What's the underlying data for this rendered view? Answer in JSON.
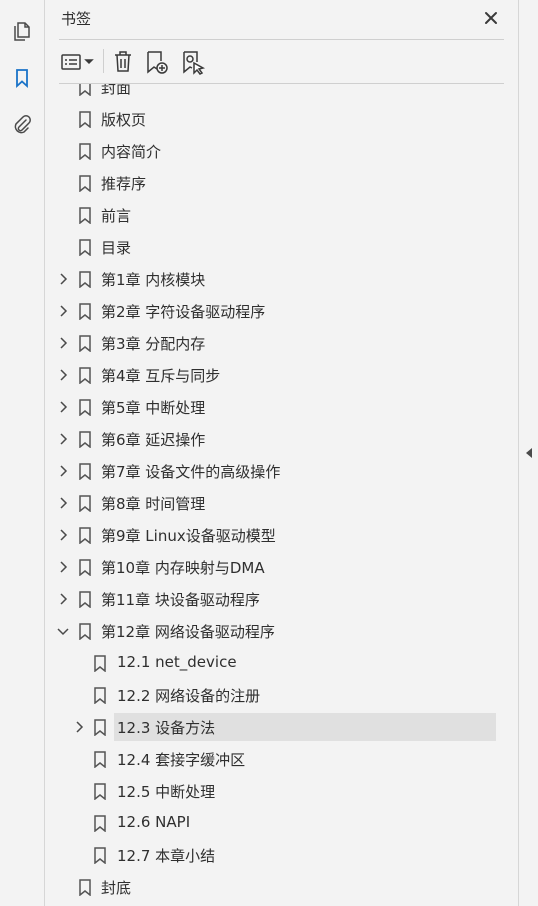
{
  "rail": {
    "pages_icon": "pages-icon",
    "bookmarks_icon": "bookmark-icon",
    "attachments_icon": "paperclip-icon",
    "accent": "#1a73c8"
  },
  "panel": {
    "title": "书签",
    "close_icon": "close-icon"
  },
  "toolbar": {
    "options_icon": "list-options-icon",
    "delete_icon": "trash-icon",
    "new_bookmark_icon": "new-bookmark-icon",
    "new_from_structure_icon": "bookmark-from-structure-icon"
  },
  "bookmarks": [
    {
      "label": "封面",
      "level": 0,
      "expandable": false
    },
    {
      "label": "版权页",
      "level": 0,
      "expandable": false
    },
    {
      "label": "内容简介",
      "level": 0,
      "expandable": false
    },
    {
      "label": "推荐序",
      "level": 0,
      "expandable": false
    },
    {
      "label": "前言",
      "level": 0,
      "expandable": false
    },
    {
      "label": "目录",
      "level": 0,
      "expandable": false
    },
    {
      "label": "第1章 内核模块",
      "level": 0,
      "expandable": true,
      "expanded": false
    },
    {
      "label": "第2章 字符设备驱动程序",
      "level": 0,
      "expandable": true,
      "expanded": false
    },
    {
      "label": "第3章 分配内存",
      "level": 0,
      "expandable": true,
      "expanded": false
    },
    {
      "label": "第4章 互斥与同步",
      "level": 0,
      "expandable": true,
      "expanded": false
    },
    {
      "label": "第5章 中断处理",
      "level": 0,
      "expandable": true,
      "expanded": false
    },
    {
      "label": "第6章 延迟操作",
      "level": 0,
      "expandable": true,
      "expanded": false
    },
    {
      "label": "第7章 设备文件的高级操作",
      "level": 0,
      "expandable": true,
      "expanded": false
    },
    {
      "label": "第8章 时间管理",
      "level": 0,
      "expandable": true,
      "expanded": false
    },
    {
      "label": "第9章 Linux设备驱动模型",
      "level": 0,
      "expandable": true,
      "expanded": false
    },
    {
      "label": "第10章 内存映射与DMA",
      "level": 0,
      "expandable": true,
      "expanded": false
    },
    {
      "label": "第11章 块设备驱动程序",
      "level": 0,
      "expandable": true,
      "expanded": false
    },
    {
      "label": "第12章 网络设备驱动程序",
      "level": 0,
      "expandable": true,
      "expanded": true
    },
    {
      "label": "12.1 net_device",
      "level": 1,
      "expandable": false
    },
    {
      "label": "12.2 网络设备的注册",
      "level": 1,
      "expandable": false
    },
    {
      "label": "12.3 设备方法",
      "level": 1,
      "expandable": true,
      "expanded": false,
      "selected": true
    },
    {
      "label": "12.4 套接字缓冲区",
      "level": 1,
      "expandable": false
    },
    {
      "label": "12.5 中断处理",
      "level": 1,
      "expandable": false
    },
    {
      "label": "12.6 NAPI",
      "level": 1,
      "expandable": false
    },
    {
      "label": "12.7 本章小结",
      "level": 1,
      "expandable": false
    },
    {
      "label": "封底",
      "level": 0,
      "expandable": false
    }
  ]
}
